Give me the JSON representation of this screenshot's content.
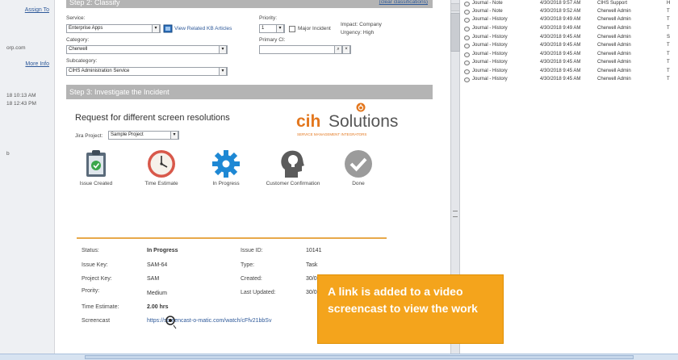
{
  "left_panel": {
    "assign_link": "Assign To",
    "domain_fragment": "orp.com",
    "more_info_link": "More Info",
    "time_1": "18 10:13 AM",
    "time_2": "18 12:43 PM",
    "fragment_b": "b"
  },
  "step2": {
    "title": "Step 2: Classify",
    "clear_link": "(clear classifications)",
    "service_label": "Service:",
    "service_value": "Enterprise Apps",
    "view_kb_link": "View Related KB Articles",
    "priority_label": "Priority:",
    "priority_value": "1",
    "major_incident_label": "Major Incident",
    "impact_text": "Impact: Company",
    "urgency_text": "Urgency: High",
    "category_label": "Category:",
    "category_value": "Cherwell",
    "primary_ci_label": "Primary CI:",
    "primary_ci_value": "",
    "subcategory_label": "Subcategory:",
    "subcategory_value": "CIHS Administration Service"
  },
  "step3": {
    "title": "Step 3:  Investigate the Incident"
  },
  "jira": {
    "title": "Request for different screen resolutions",
    "project_label": "Jira Project:",
    "project_value": "Sample Project",
    "logo_cih": "cih",
    "logo_solutions": "Solutions",
    "logo_tagline": "SERVICE MANAGEMENT INTEGRATORS",
    "stages": [
      {
        "label": "Issue Created",
        "icon": "clipboard-check-icon"
      },
      {
        "label": "Time Estimate",
        "icon": "clock-icon"
      },
      {
        "label": "In Progress",
        "icon": "gear-icon"
      },
      {
        "label": "Customer Confirmation",
        "icon": "head-lightbulb-icon"
      },
      {
        "label": "Done",
        "icon": "checkmark-circle-icon"
      }
    ],
    "details": {
      "status_label": "Status:",
      "status_value": "In Progress",
      "issue_key_label": "Issue Key:",
      "issue_key_value": "SAM-64",
      "project_key_label": "Project Key:",
      "project_key_value": "SAM",
      "priority_label": "Prority:",
      "priority_value": "Medium",
      "time_estimate_label": "Time Estimate:",
      "time_estimate_value": "2.00 hrs",
      "screencast_label": "Screencast",
      "screencast_value": "https://screencast-o-matic.com/watch/cFfv21bbSv",
      "issue_id_label": "Issue ID:",
      "issue_id_value": "10141",
      "type_label": "Type:",
      "type_value": "Task",
      "created_label": "Created:",
      "created_value": "30/0",
      "last_updated_label": "Last Updated:",
      "last_updated_value": "30/0"
    }
  },
  "journal": {
    "rows": [
      {
        "type": "Journal - Note",
        "date": "4/30/2018 9:57 AM",
        "user": "CIHS Support",
        "extra": "H"
      },
      {
        "type": "Journal - Note",
        "date": "4/30/2018 9:52 AM",
        "user": "Cherwell Admin",
        "extra": "T"
      },
      {
        "type": "Journal - History",
        "date": "4/30/2018 9:49 AM",
        "user": "Cherwell Admin",
        "extra": "T"
      },
      {
        "type": "Journal - History",
        "date": "4/30/2018 9:49 AM",
        "user": "Cherwell Admin",
        "extra": "T"
      },
      {
        "type": "Journal - History",
        "date": "4/30/2018 9:45 AM",
        "user": "Cherwell Admin",
        "extra": "S"
      },
      {
        "type": "Journal - History",
        "date": "4/30/2018 9:45 AM",
        "user": "Cherwell Admin",
        "extra": "T"
      },
      {
        "type": "Journal - History",
        "date": "4/30/2018 9:45 AM",
        "user": "Cherwell Admin",
        "extra": "T"
      },
      {
        "type": "Journal - History",
        "date": "4/30/2018 9:45 AM",
        "user": "Cherwell Admin",
        "extra": "T"
      },
      {
        "type": "Journal - History",
        "date": "4/30/2018 9:45 AM",
        "user": "Cherwell Admin",
        "extra": "T"
      },
      {
        "type": "Journal - History",
        "date": "4/30/2018 9:45 AM",
        "user": "Cherwell Admin",
        "extra": "T"
      }
    ]
  },
  "callout": {
    "text": "A link is added to a video screencast to view the work"
  },
  "colors": {
    "accent_orange": "#f4a41c",
    "link_blue": "#2f5a9a",
    "gear_blue": "#1e88d4",
    "clock_red": "#d8584a",
    "check_green": "#3aa64a"
  }
}
